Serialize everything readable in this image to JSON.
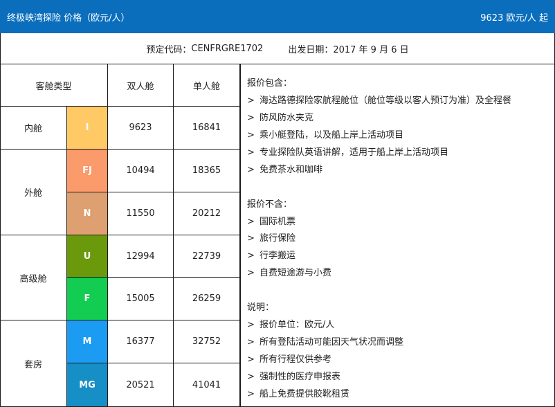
{
  "header": {
    "title": "终极峡湾探险  价格（欧元/人）",
    "price": "9623 欧元/人  起"
  },
  "subheader": {
    "code_label": "预定代码：",
    "code_value": "CENFRGRE1702",
    "date_label": "出发日期：",
    "date_value": "2017 年 9 月 6 日"
  },
  "table": {
    "col_type": "客舱类型",
    "col_double": "双人舱",
    "col_single": "单人舱",
    "groups": [
      "内舱",
      "外舱",
      "高级舱",
      "套房"
    ],
    "rows": [
      {
        "code": "I",
        "color": "#ffc966",
        "double": "9623",
        "single": "16841"
      },
      {
        "code": "FJ",
        "color": "#fb9a6b",
        "double": "10494",
        "single": "18365"
      },
      {
        "code": "N",
        "color": "#dea070",
        "double": "11550",
        "single": "20212"
      },
      {
        "code": "U",
        "color": "#6a9a0c",
        "double": "12994",
        "single": "22739"
      },
      {
        "code": "F",
        "color": "#13cc52",
        "double": "15005",
        "single": "26259"
      },
      {
        "code": "M",
        "color": "#1b9cf2",
        "double": "16377",
        "single": "32752"
      },
      {
        "code": "MG",
        "color": "#168ec6",
        "double": "20521",
        "single": "41041"
      }
    ]
  },
  "notes": {
    "arrow": ">",
    "included_title": "报价包含：",
    "included": [
      "海达路德探险家航程舱位（舱位等级以客人预订为准）及全程餐",
      "防风防水夹克",
      "乘小艇登陆，以及船上岸上活动项目",
      "专业探险队英语讲解，适用于船上岸上活动项目",
      "免费茶水和咖啡"
    ],
    "excluded_title": "报价不含：",
    "excluded": [
      "国际机票",
      "旅行保险",
      "行李搬运",
      "自费短途游与小费"
    ],
    "remarks_title": "说明：",
    "remarks": [
      "报价单位：欧元/人",
      "所有登陆活动可能因天气状况而调整",
      "所有行程仅供参考",
      "强制性的医疗申报表",
      "船上免费提供胶靴租赁"
    ]
  }
}
